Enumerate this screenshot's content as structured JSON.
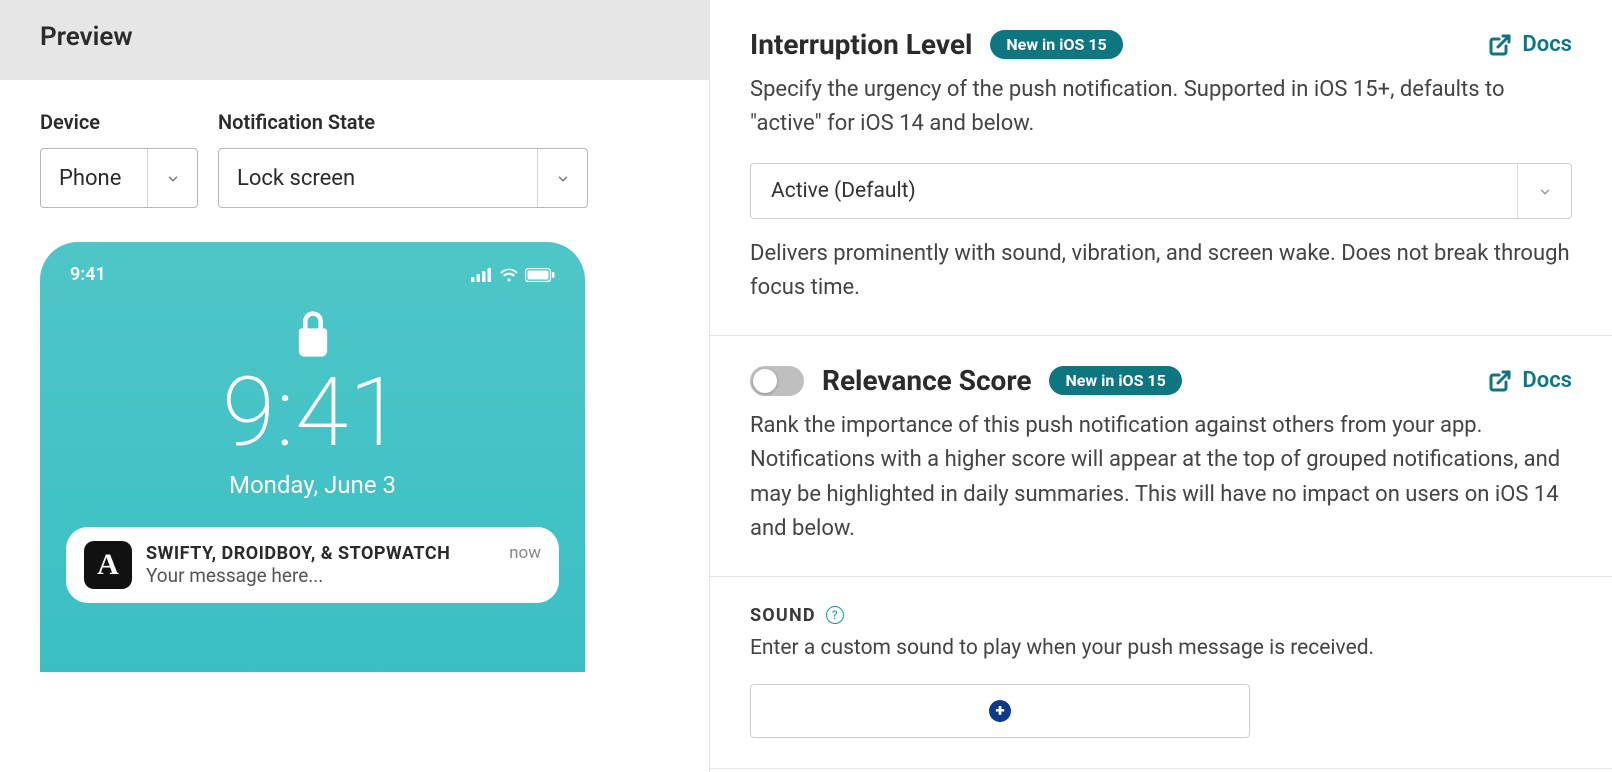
{
  "preview": {
    "title": "Preview",
    "device_label": "Device",
    "device_value": "Phone",
    "state_label": "Notification State",
    "state_value": "Lock screen",
    "phone": {
      "status_time": "9:41",
      "big_time": "9:41",
      "big_date": "Monday, June 3",
      "notif_app_icon_letter": "A",
      "notif_title": "SWIFTY, DROIDBOY, & STOPWATCH",
      "notif_message": "Your message here...",
      "notif_time": "now"
    }
  },
  "interruption": {
    "title": "Interruption Level",
    "badge": "New in iOS 15",
    "docs_label": "Docs",
    "description": "Specify the urgency of the push notification. Supported in iOS 15+, defaults to \"active\" for iOS 14 and below.",
    "selected": "Active (Default)",
    "helper": "Delivers prominently with sound, vibration, and screen wake. Does not break through focus time."
  },
  "relevance": {
    "title": "Relevance Score",
    "badge": "New in iOS 15",
    "docs_label": "Docs",
    "description": "Rank the importance of this push notification against others from your app. Notifications with a higher score will appear at the top of grouped notifications, and may be highlighted in daily summaries. This will have no impact on users on iOS 14 and below."
  },
  "sound": {
    "label": "SOUND",
    "description": "Enter a custom sound to play when your push message is received."
  }
}
